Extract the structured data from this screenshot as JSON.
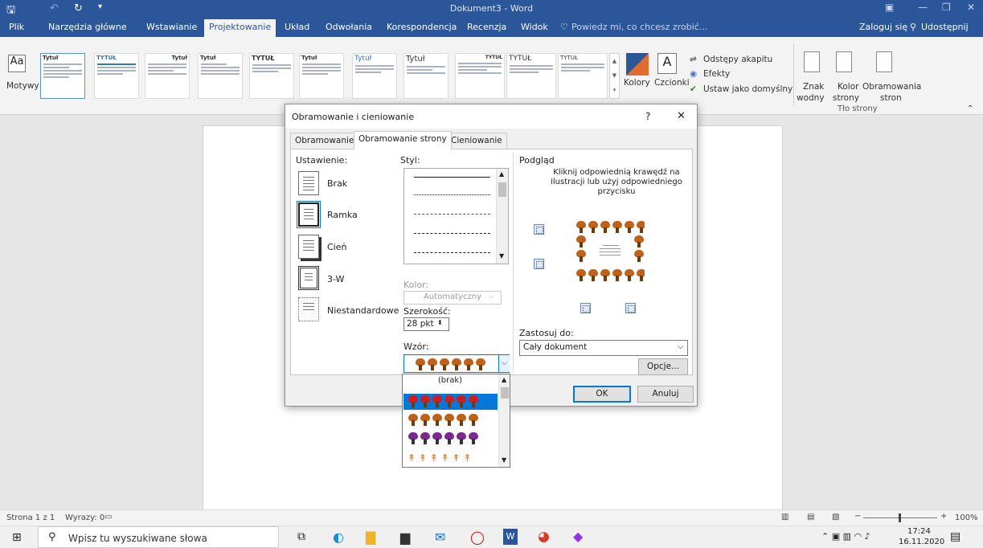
{
  "titlebar": {
    "title": "Dokument3 - Word"
  },
  "tabs": [
    {
      "label": "Plik"
    },
    {
      "label": "Narzędzia główne"
    },
    {
      "label": "Wstawianie"
    },
    {
      "label": "Projektowanie"
    },
    {
      "label": "Układ"
    },
    {
      "label": "Odwołania"
    },
    {
      "label": "Korespondencja"
    },
    {
      "label": "Recenzja"
    },
    {
      "label": "Widok"
    },
    {
      "label": "Powiedz mi, co chcesz zrobić..."
    }
  ],
  "account": {
    "signin": "Zaloguj się",
    "share": "Udostępnij"
  },
  "ribbon": {
    "themes_label": "Motywy",
    "styles": [
      "Tytuł",
      "TYTUŁ",
      "Tytuł",
      "Tytuł",
      "TYTUŁ",
      "Tytuł",
      "Tytuł",
      "Tytuł",
      "TYTUŁ",
      "TYTUŁ"
    ],
    "colors_label": "Kolory",
    "fonts_label": "Czcionki",
    "para_spacing": "Odstępy akapitu",
    "effects": "Efekty",
    "set_default": "Ustaw jako domyślny",
    "watermark_1": "Znak",
    "watermark_2": "wodny",
    "pagecolor_1": "Kolor",
    "pagecolor_2": "strony",
    "pageborders_1": "Obramowania",
    "pageborders_2": "stron",
    "group_label": "Tło strony"
  },
  "statusbar": {
    "page": "Strona 1 z 1",
    "words": "Wyrazy: 0",
    "zoom": "100%"
  },
  "taskbar": {
    "search_placeholder": "Wpisz tu wyszukiwane słowa",
    "time": "17:24",
    "date": "16.11.2020"
  },
  "dialog": {
    "title": "Obramowanie i cieniowanie",
    "help": "?",
    "close": "✕",
    "tabs": [
      "Obramowanie",
      "Obramowanie strony",
      "Cieniowanie"
    ],
    "settings_label": "Ustawienie:",
    "settings": [
      "Brak",
      "Ramka",
      "Cień",
      "3-W",
      "Niestandardowe"
    ],
    "style_label": "Styl:",
    "color_label": "Kolor:",
    "color_value": "Automatyczny",
    "width_label": "Szerokość:",
    "width_value": "28 pkt",
    "art_label": "Wzór:",
    "art_none": "(brak)",
    "preview_label": "Podgląd",
    "preview_hint": "Kliknij odpowiednią krawędź na ilustracji lub użyj odpowiedniego przycisku",
    "apply_label": "Zastosuj do:",
    "apply_value": "Cały dokument",
    "options_btn": "Opcje...",
    "ok_btn": "OK",
    "cancel_btn": "Anuluj"
  },
  "colors": {
    "word_blue": "#2b579a",
    "selection": "#0078d7",
    "art_brown": "#c0611a"
  }
}
